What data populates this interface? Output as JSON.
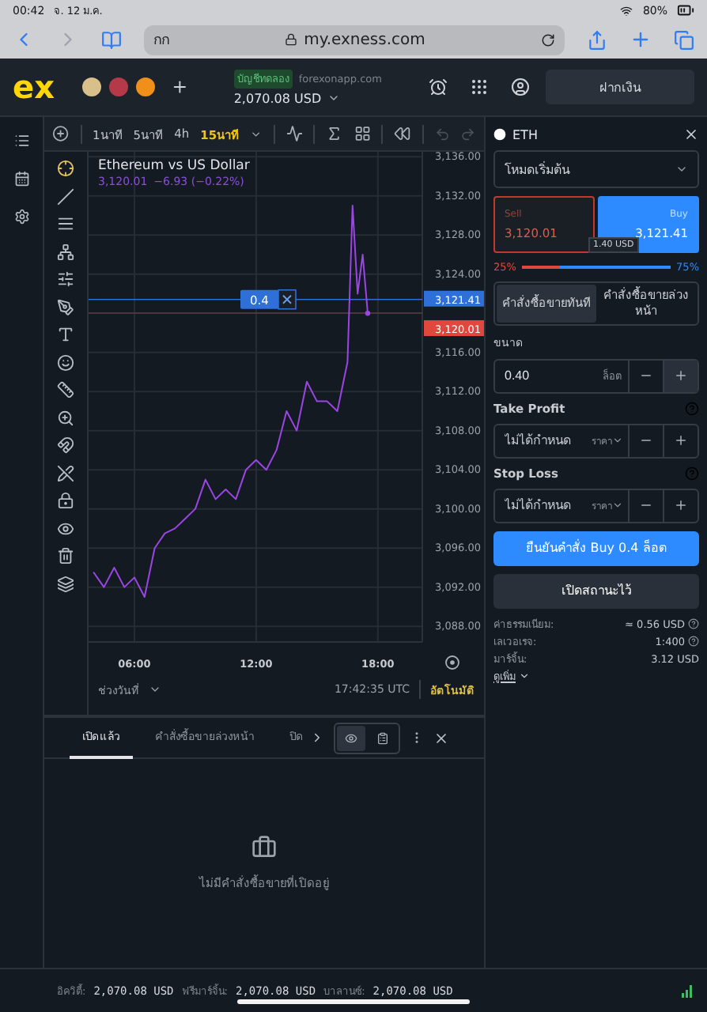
{
  "status_bar": {
    "time": "00:42",
    "date": "จ. 12 ม.ค.",
    "battery": "80%"
  },
  "browser": {
    "text_size": "กก",
    "url": "my.exness.com"
  },
  "app_header": {
    "logo": "ex",
    "account_type": "บัญชีทดลอง",
    "server": "forexonapp.com",
    "balance": "2,070.08 USD",
    "deposit_button": "ฝากเงิน"
  },
  "chart_toolbar": {
    "timeframes": [
      {
        "label": "1นาที",
        "selected": false
      },
      {
        "label": "5นาที",
        "selected": false
      },
      {
        "label": "4h",
        "selected": false
      },
      {
        "label": "15นาที",
        "selected": true
      }
    ]
  },
  "chart": {
    "title": "Ethereum vs US Dollar",
    "quote": "3,120.01",
    "change": "−6.93 (−0.22%)",
    "order_line": {
      "lots": "0.4"
    },
    "ask_tag": "3,121.41",
    "bid_tag": "3,120.01",
    "date_range": "ช่วงวันที่",
    "clock": "17:42:35 UTC",
    "auto_scale": "อัตโนมัติ",
    "chart_data": {
      "type": "line",
      "x": [
        4,
        4.5,
        5,
        5.5,
        6,
        6.5,
        7,
        7.5,
        8,
        8.5,
        9,
        9.5,
        10,
        10.5,
        11,
        11.5,
        12,
        12.5,
        13,
        13.5,
        14,
        14.5,
        15,
        15.5,
        16,
        16.5,
        16.75,
        17,
        17.25,
        17.5
      ],
      "xlim": [
        3.74,
        20.19
      ],
      "ylim": [
        3086.4,
        3136.5
      ],
      "grid": true,
      "ref_lines": [
        {
          "axis": "y",
          "value": 3121.41,
          "color": "#2e6fd8"
        },
        {
          "axis": "y",
          "value": 3120.01,
          "color": "#5a4046"
        }
      ],
      "series": [
        {
          "color": "#9b45e4",
          "values": [
            3093.5,
            3092,
            3094,
            3092,
            3093,
            3091,
            3096,
            3097.5,
            3098,
            3099,
            3100,
            3103,
            3101,
            3102,
            3101,
            3104,
            3105,
            3104,
            3106,
            3110,
            3108,
            3113,
            3111,
            3111,
            3110,
            3115,
            3131,
            3122,
            3126,
            3120
          ]
        }
      ],
      "xticks": [
        {
          "value": 6,
          "label": "06:00"
        },
        {
          "value": 12,
          "label": "12:00"
        },
        {
          "value": 18,
          "label": "18:00"
        }
      ],
      "yticks": [
        {
          "value": 3088,
          "label": "3,088.00"
        },
        {
          "value": 3092,
          "label": "3,092.00"
        },
        {
          "value": 3096,
          "label": "3,096.00"
        },
        {
          "value": 3100,
          "label": "3,100.00"
        },
        {
          "value": 3104,
          "label": "3,104.00"
        },
        {
          "value": 3108,
          "label": "3,108.00"
        },
        {
          "value": 3112,
          "label": "3,112.00"
        },
        {
          "value": 3116,
          "label": "3,116.00"
        },
        {
          "value": 3124,
          "label": "3,124.00"
        },
        {
          "value": 3128,
          "label": "3,128.00"
        },
        {
          "value": 3132,
          "label": "3,132.00"
        },
        {
          "value": 3136,
          "label": "3,136.00"
        }
      ]
    }
  },
  "positions_panel": {
    "tabs": [
      {
        "label": "เปิดแล้ว",
        "selected": true
      },
      {
        "label": "คำสั่งซื้อขายล่วงหน้า",
        "selected": false
      },
      {
        "label": "ปิด",
        "selected": false
      }
    ],
    "view_modes": [
      {
        "selected": true
      },
      {
        "selected": false
      }
    ],
    "empty_message": "ไม่มีคำสั่งซื้อขายที่เปิดอยู่"
  },
  "order_panel": {
    "symbol": "ETH",
    "mode": "โหมดเริ่มต้น",
    "sell": {
      "label": "Sell",
      "price": "3,120.01",
      "selected": false
    },
    "buy": {
      "label": "Buy",
      "price": "3,121.41",
      "selected": true
    },
    "spread": "1.40 USD",
    "sentiment": {
      "sell": "25%",
      "buy": "75%",
      "level": 0.25
    },
    "order_types": [
      {
        "label": "คำสั่งซื้อขายทันที",
        "selected": true
      },
      {
        "label": "คำสั่งซื้อขายล่วงหน้า",
        "selected": false
      }
    ],
    "volume": {
      "label": "ขนาด",
      "value": "0.40",
      "unit": "ล็อต"
    },
    "take_profit": {
      "label": "Take Profit",
      "placeholder": "ไม่ได้กำหนด",
      "mode": "ราคา"
    },
    "stop_loss": {
      "label": "Stop Loss",
      "placeholder": "ไม่ได้กำหนด",
      "mode": "ราคา"
    },
    "confirm_button": "ยืนยันคำสั่ง Buy 0.4 ล็อต",
    "hold_button": "เปิดสถานะไว้",
    "details": [
      {
        "label": "ค่าธรรมเนียม:",
        "value": "≈ 0.56 USD",
        "info": true
      },
      {
        "label": "เลเวอเรจ:",
        "value": "1:400",
        "info": true
      },
      {
        "label": "มาร์จิ้น:",
        "value": "3.12 USD",
        "info": false
      }
    ],
    "more_link": "ดูเพิ่ม"
  },
  "footer": {
    "items": [
      {
        "label": "อิควิตี้:",
        "value": "2,070.08 USD"
      },
      {
        "label": "ฟรีมาร์จิ้น:",
        "value": "2,070.08 USD"
      },
      {
        "label": "บาลานซ์:",
        "value": "2,070.08 USD"
      }
    ]
  }
}
